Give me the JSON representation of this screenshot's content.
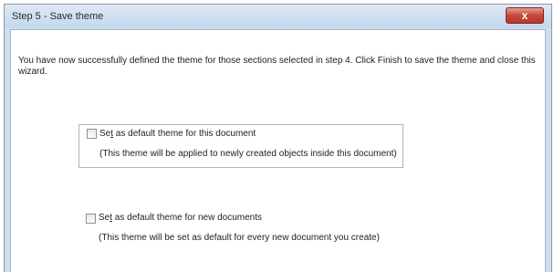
{
  "window": {
    "title": "Step 5 - Save theme",
    "close_glyph": "x"
  },
  "intro_text": "You have now successfully defined the theme for those sections selected in step 4. Click Finish to save the theme and close this wizard.",
  "options": [
    {
      "label_prefix": "Se",
      "label_accel": "t",
      "label_rest": " as default theme for this document",
      "description": "(This theme will be applied to newly created objects inside this document)",
      "checked": false
    },
    {
      "label_prefix": "Se",
      "label_accel": "t",
      "label_rest": " as default theme for new documents",
      "description": "(This theme will be set as default for every new document you create)",
      "checked": false
    }
  ]
}
